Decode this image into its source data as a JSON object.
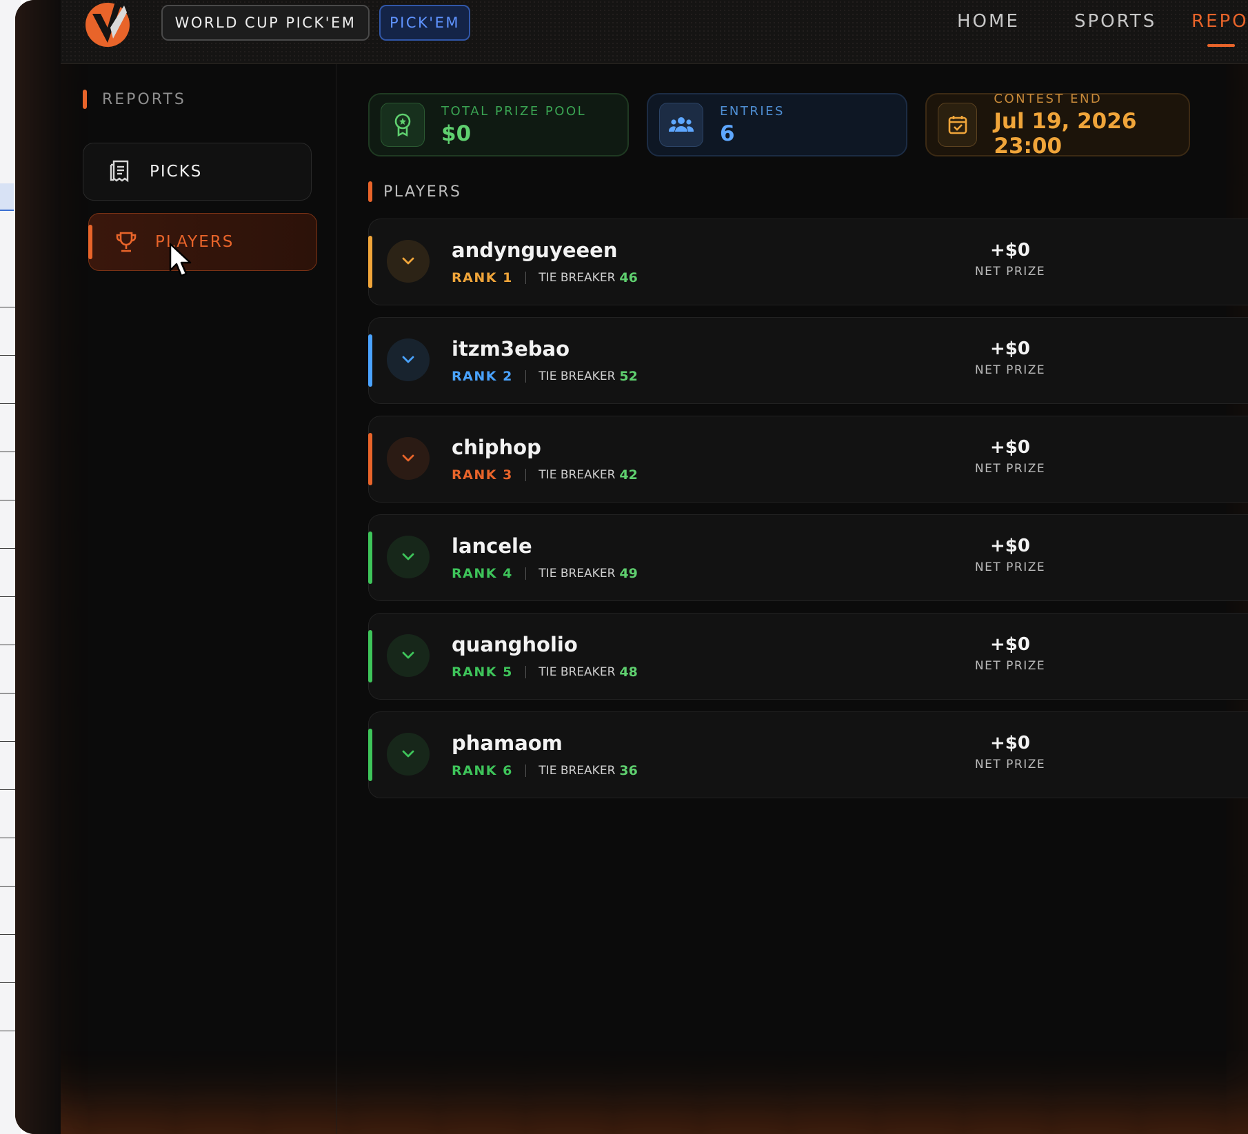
{
  "nav": {
    "contest_title": "WORLD CUP PICK'EM",
    "mode_chip": "PICK'EM",
    "items": [
      {
        "label": "HOME",
        "active": false
      },
      {
        "label": "SPORTS",
        "active": false
      },
      {
        "label": "REPORT",
        "active": true
      }
    ]
  },
  "sidebar": {
    "heading": "REPORTS",
    "items": [
      {
        "label": "PICKS",
        "icon": "receipt-icon",
        "active": false
      },
      {
        "label": "PLAYERS",
        "icon": "trophy-icon",
        "active": true
      }
    ]
  },
  "stats": {
    "prize_pool": {
      "label": "TOTAL PRIZE POOL",
      "value": "$0",
      "icon": "award-icon"
    },
    "entries": {
      "label": "ENTRIES",
      "value": "6",
      "icon": "users-icon"
    },
    "contest_end": {
      "label": "CONTEST END",
      "value": "Jul 19, 2026 23:00",
      "icon": "calendar-check-icon"
    }
  },
  "players_section": {
    "heading": "PLAYERS",
    "tie_breaker_label": "TIE BREAKER",
    "net_prize_label": "NET PRIZE",
    "rows": [
      {
        "name": "andynguyeeen",
        "rank": "RANK 1",
        "tie_breaker": "46",
        "net_prize": "+$0",
        "color": "#f0a53a"
      },
      {
        "name": "itzm3ebao",
        "rank": "RANK 2",
        "tie_breaker": "52",
        "net_prize": "+$0",
        "color": "#4aa3ff"
      },
      {
        "name": "chiphop",
        "rank": "RANK 3",
        "tie_breaker": "42",
        "net_prize": "+$0",
        "color": "#e8642a"
      },
      {
        "name": "lancele",
        "rank": "RANK 4",
        "tie_breaker": "49",
        "net_prize": "+$0",
        "color": "#3ec45a"
      },
      {
        "name": "quangholio",
        "rank": "RANK 5",
        "tie_breaker": "48",
        "net_prize": "+$0",
        "color": "#3ec45a"
      },
      {
        "name": "phamaom",
        "rank": "RANK 6",
        "tie_breaker": "36",
        "net_prize": "+$0",
        "color": "#3ec45a"
      }
    ]
  },
  "colors": {
    "accent": "#e8642a",
    "prize_green": "#5fd06f",
    "entries_blue": "#5ea7ff",
    "end_gold": "#f0a53a"
  }
}
